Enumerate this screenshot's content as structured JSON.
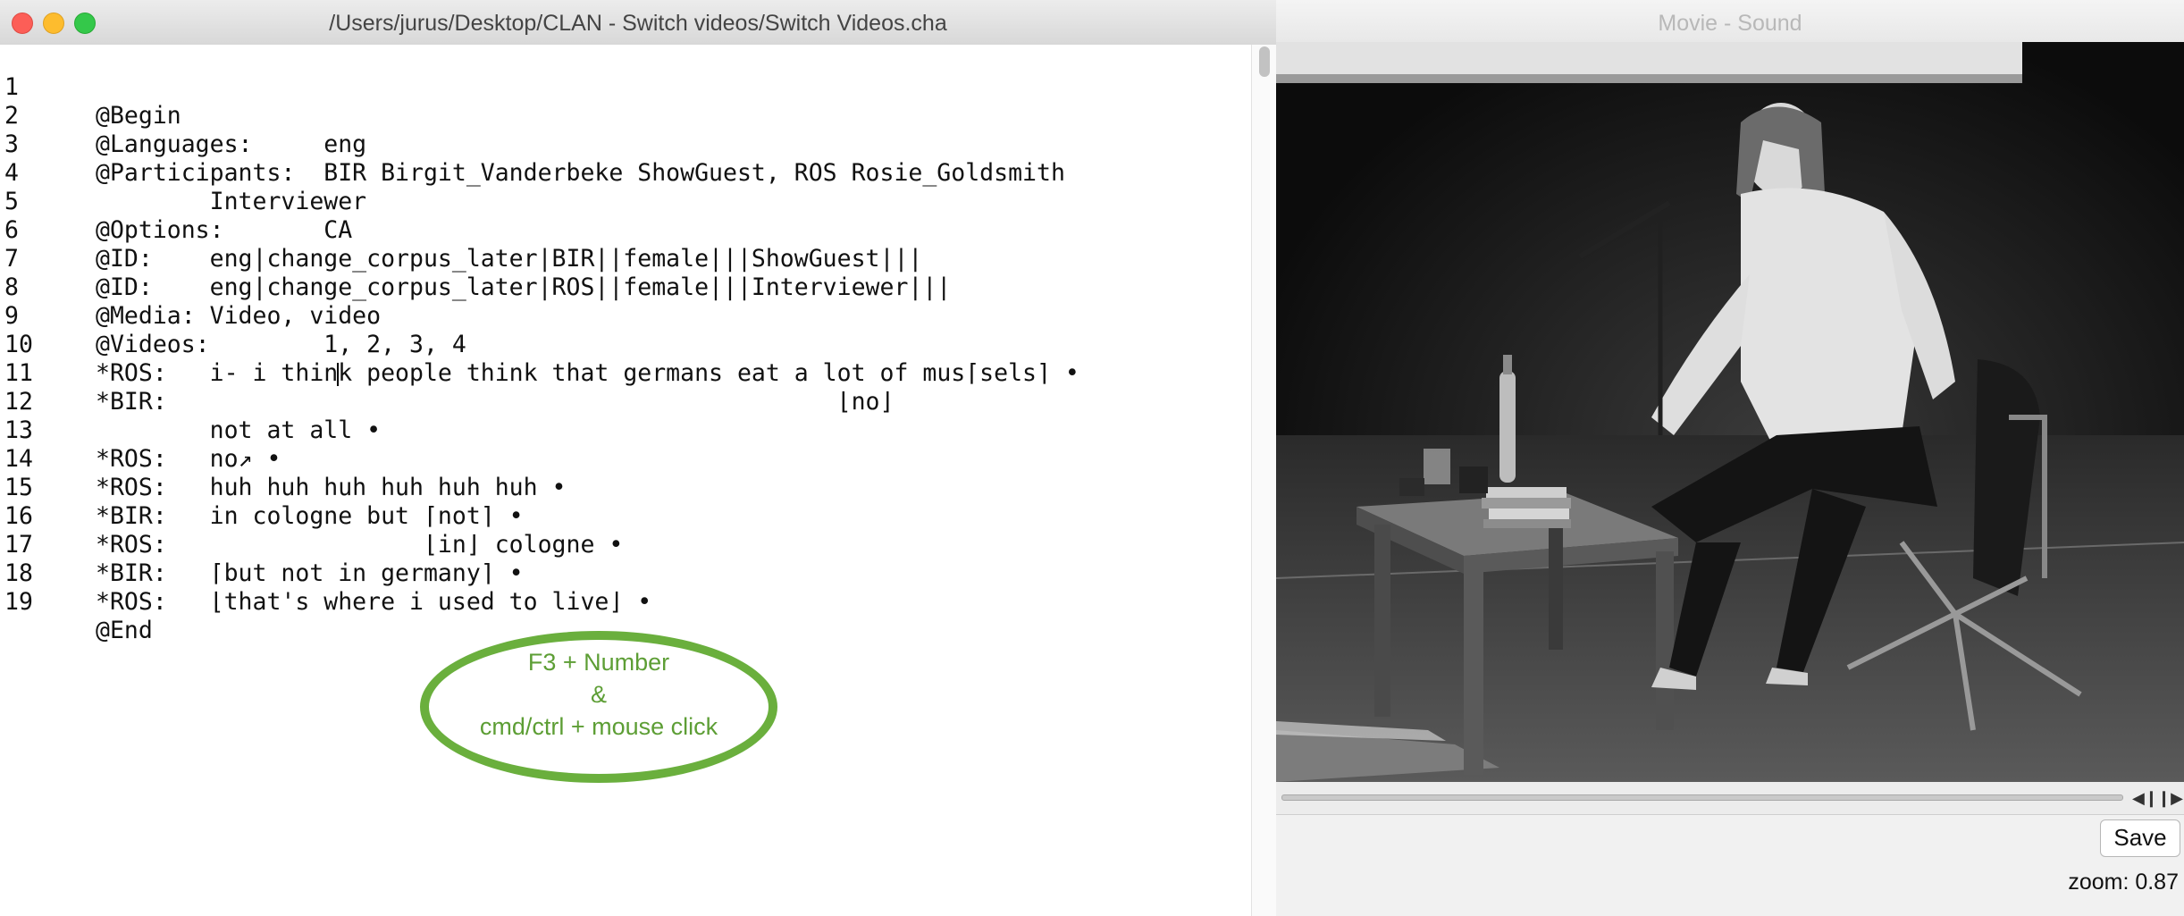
{
  "editor": {
    "title": "/Users/jurus/Desktop/CLAN - Switch videos/Switch Videos.cha",
    "lines": [
      {
        "num": "1",
        "text": "@Begin"
      },
      {
        "num": "2",
        "text": "@Languages:\teng"
      },
      {
        "num": "3",
        "text": "@Participants:\tBIR Birgit_Vanderbeke ShowGuest, ROS Rosie_Goldsmith"
      },
      {
        "num": "4",
        "text": "\tInterviewer"
      },
      {
        "num": "5",
        "text": "@Options:\tCA"
      },
      {
        "num": "6",
        "text": "@ID:\teng|change_corpus_later|BIR||female|||ShowGuest|||"
      },
      {
        "num": "7",
        "text": "@ID:\teng|change_corpus_later|ROS||female|||Interviewer|||"
      },
      {
        "num": "8",
        "text": "@Media:\tVideo, video"
      },
      {
        "num": "9",
        "text": "@Videos:\t1, 2, 3, 4"
      },
      {
        "num": "10",
        "text_before": "*ROS:\ti- i thin",
        "text_after": "k people think that germans eat a lot of mus⌈sels⌉ •"
      },
      {
        "num": "11",
        "text": "*BIR:\t                                            ⌊no⌋"
      },
      {
        "num": "12",
        "text": "\tnot at all •"
      },
      {
        "num": "13",
        "text": "*ROS:\tno↗ •"
      },
      {
        "num": "14",
        "text": "*ROS:\thuh huh huh huh huh huh •"
      },
      {
        "num": "15",
        "text": "*BIR:\tin cologne but ⌈not⌉ •"
      },
      {
        "num": "16",
        "text": "*ROS:\t               ⌊in⌋ cologne •"
      },
      {
        "num": "17",
        "text": "*BIR:\t⌈but not in germany⌉ •"
      },
      {
        "num": "18",
        "text": "*ROS:\t⌊that's where i used to live⌋ •"
      },
      {
        "num": "19",
        "text": "@End"
      }
    ]
  },
  "annotation": {
    "line1": "F3 + Number",
    "line2": "&",
    "line3": "cmd/ctrl + mouse click",
    "color": "#6aaf3d"
  },
  "movie": {
    "title": "Movie - Sound",
    "step_back_icon": "step-back-icon",
    "step_forward_icon": "step-forward-icon",
    "save_label": "Save",
    "zoom_label": "zoom: 0.87"
  }
}
